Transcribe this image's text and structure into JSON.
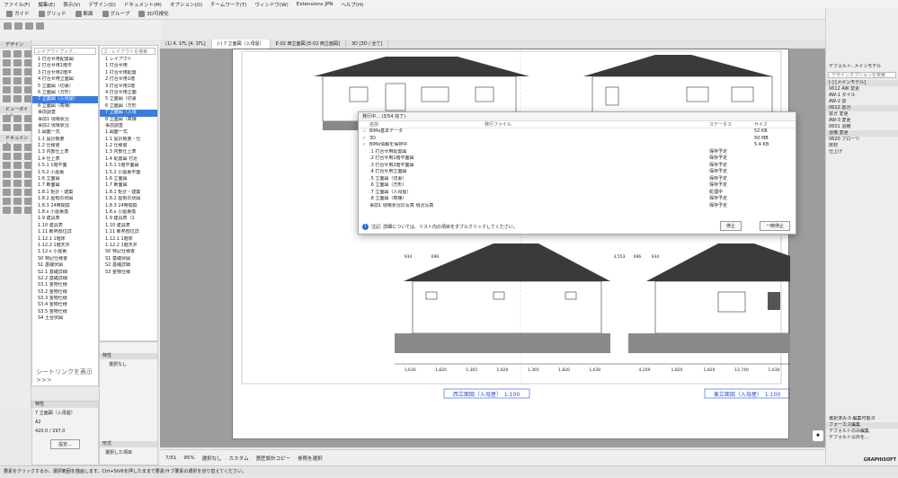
{
  "menu": [
    "ファイル(F)",
    "編集(E)",
    "表示(V)",
    "デザイン(D)",
    "ドキュメント(M)",
    "オプション(O)",
    "チームワーク(T)",
    "ウィンドウ(W)",
    "Extensions JPN",
    "ヘルプ(H)"
  ],
  "toolbar": {
    "items": [
      "ガイド",
      "グリッド",
      "断面",
      "グループ",
      "3D可視化"
    ]
  },
  "toolbox": {
    "design_label": "デザイン",
    "viewpoint_label": "ビューポイント",
    "document_label": "ドキュメント"
  },
  "navigator_left": {
    "search_placeholder": "レイアウトブック...",
    "rows": [
      "1 打合せ用配置図",
      "2 打合せ用1階平",
      "3 打合せ用2階平",
      "4 打合せ用立面図",
      "5 立面図（切妻）",
      "6 立面図（方形）",
      "7 立面図（入母屋）",
      "8 立面図（寄棟）",
      "事前調査",
      "事前1 現場状況",
      "事前2 現場状況",
      "1 図面一式",
      "1.1 設計概要",
      "1.2 仕様書",
      "1.3 内部仕上表",
      "1.4 仕上表",
      "1.5.1 1階平面",
      "1.5.2 小屋裏",
      "1.6 立面図",
      "1.7 断面図",
      "1.8.1 矩計・建築",
      "1.8.2 屋根の伏図",
      "1.8.3 24時間換",
      "1.8.x 小屋裏換",
      "1.9 建具表",
      "1.10 建具表",
      "1.11 断熱部位詳",
      "1.12.1 1階床",
      "1.12.2 1階天井",
      "1.12.x 小屋裏",
      "S0 特記仕様書",
      "S1 基礎伏図",
      "S2.1 基礎詳細",
      "S2.2 基礎詳細",
      "S3.1 金物仕様",
      "S3.2 金物仕様",
      "S3.3 金物仕様",
      "S3.4 金物仕様",
      "S3.5 金物仕様",
      "S4 土台伏図"
    ],
    "selected_index": 6,
    "sheet_link": "シートリンクを表示 >>>"
  },
  "navigator_right": {
    "search_placeholder": "2 - レイアウトを検索",
    "rows": [
      "1 レイアウト",
      "1 打合せ用",
      "1 打合せ用配置",
      "2 打合せ用1階",
      "3 打合せ用2階",
      "4 打合せ用立面",
      "5 立面図（切妻",
      "6 立面図（方形",
      "7 立面図（入母",
      "8 立面図（寄棟",
      "事前調査",
      "1 図面一式",
      "1.1 設計概要・仕",
      "1.2 仕様書",
      "1.3 内部仕上表",
      "1.4 配置図 付近",
      "1.5.1 1階平面図",
      "1.5.2 小屋裏平面",
      "1.6 立面図",
      "1.7 断面図",
      "1.8.1 矩計・建築",
      "1.8.2 屋根の伏図",
      "1.8.3 24時間換",
      "1.8.x 小屋裏換",
      "1.9 建具表（1",
      "1.10 建具表",
      "1.11 断熱部位詳",
      "1.12.1 1階床",
      "1.12.2 1階天井",
      "S0 特記仕様書",
      "S1 基礎伏図",
      "S2 基礎詳細",
      "S3 金物仕様"
    ],
    "selected_index": 8
  },
  "info_panel": {
    "title": "特性",
    "name": "7 立面図（入母屋）",
    "size_label": "A2",
    "size_value": "420.0 / 297.0",
    "settings_button": "設定..."
  },
  "info_panel2": {
    "title": "特性",
    "value": "選択なし",
    "format_label": "形式",
    "selected": "選択した項目"
  },
  "tabs": [
    "(1) 4. 1FL [4. 1FL]",
    "(-) 7 立面図（入母屋）",
    "E-02 西立面図 [E-02 西立面図]",
    "3D [3D / 全て]"
  ],
  "drawing": {
    "caption_left": "西立面図（入母屋）　1:100",
    "caption_right": "東立面図（入母屋）　1:100",
    "dims_left": [
      "1,630",
      "1,820",
      "1,365",
      "1,820",
      "1,365",
      "1,820",
      "1,630"
    ],
    "dims_right": [
      "4,249",
      "1,820",
      "1,820",
      "12,740",
      "1,630"
    ],
    "dim_top_left": [
      "934",
      "696"
    ],
    "dim_top_right": [
      "3,553",
      "696",
      "934"
    ]
  },
  "dialog": {
    "title": "発行中... (3/54 完了)",
    "col_name": "名前",
    "col_file": "発行ファイル",
    "col_status": "ステータス",
    "col_size": "サイズ",
    "rows": [
      {
        "name": "BIMx基本データ",
        "status": "",
        "size": "52 KB",
        "icon": "warning-icon"
      },
      {
        "name": "3D",
        "status": "",
        "size": "50 MB",
        "icon": "check-icon"
      },
      {
        "name": "BIMx情報を保存中",
        "status": "",
        "size": "5.4 KB",
        "icon": "check-icon"
      },
      {
        "name": ".1 打合せ用配置図",
        "status": "保存予定",
        "size": "",
        "icon": ""
      },
      {
        "name": ".2 打合せ用1階平面図",
        "status": "保存予定",
        "size": "",
        "icon": ""
      },
      {
        "name": ".3 打合せ用2階平面図",
        "status": "保存予定",
        "size": "",
        "icon": ""
      },
      {
        "name": ".4 打合せ用立面図",
        "status": "保存予定",
        "size": "",
        "icon": ""
      },
      {
        "name": ".5 立面図（切妻）",
        "status": "保存予定",
        "size": "",
        "icon": ""
      },
      {
        "name": ".6 立面図（方形）",
        "status": "保存予定",
        "size": "",
        "icon": ""
      },
      {
        "name": ".7 立面図（入母屋）",
        "status": "処理中",
        "size": "",
        "icon": ""
      },
      {
        "name": ".8 立面図（寄棟）",
        "status": "保存予定",
        "size": "",
        "icon": ""
      },
      {
        "name": "事前1 現場状況の写真 現況写真",
        "status": "保存予定",
        "size": "",
        "icon": ""
      }
    ],
    "note": "注記: 詳細については、リスト内の項目をダブルクリックしてください。",
    "stop_button": "停止",
    "pause_button": "一時停止"
  },
  "right_panel": {
    "title": "デフォルト: メインモデル",
    "search_placeholder": "デザインオプションを検索",
    "rows": [
      "[-] [メインモデル]",
      "0612 AW 変更",
      "AW-1 タイル",
      "AW-2 窓",
      "0612 窓ガ",
      "窓ガ 変更",
      "AW-3 変更",
      "0601 浴槽",
      "浴槽 変更",
      "0620 フローリ",
      "床材",
      "仕上げ"
    ],
    "focus_header": "フォーカス編集",
    "focus_items": [
      "デフォルトのみ編集",
      "デフォルト以外を..."
    ],
    "selection": "選択済み:0 編集可能:0",
    "graphisoft": "GRAPHISOFT"
  },
  "bottombar": {
    "page": "7/51",
    "zoom": "95%",
    "items": [
      "選択なし",
      "カスタム",
      "意匠設計コピー",
      "参照を選択"
    ]
  },
  "statusbar": {
    "text": "要素をクリックするか、選択範囲を描画します。Ctrl+Shiftを押したままで要素/サブ要素の選択を切り替えてください。"
  },
  "colors": {
    "accent": "#3b7ddd",
    "roof": "#3a3a3a",
    "caption_blue": "#2b4fd8"
  }
}
